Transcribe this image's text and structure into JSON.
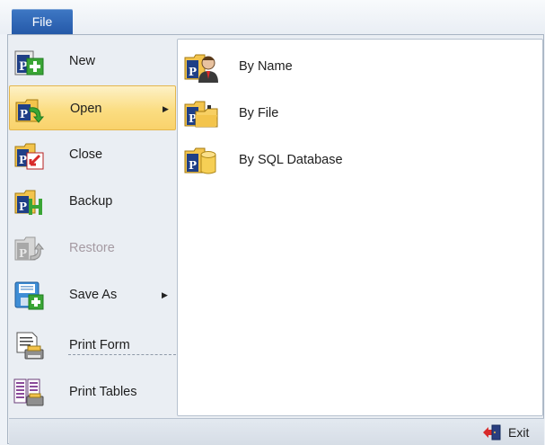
{
  "menu_tab": {
    "label": "File"
  },
  "left_menu": {
    "items": [
      {
        "label": "New",
        "icon": "new-file-icon",
        "disabled": false,
        "selected": false,
        "has_submenu": false
      },
      {
        "label": "Open",
        "icon": "open-file-icon",
        "disabled": false,
        "selected": true,
        "has_submenu": true
      },
      {
        "label": "Close",
        "icon": "close-file-icon",
        "disabled": false,
        "selected": false,
        "has_submenu": false
      },
      {
        "label": "Backup",
        "icon": "backup-icon",
        "disabled": false,
        "selected": false,
        "has_submenu": false
      },
      {
        "label": "Restore",
        "icon": "restore-icon",
        "disabled": true,
        "selected": false,
        "has_submenu": false
      },
      {
        "label": "Save As",
        "icon": "save-as-icon",
        "disabled": false,
        "selected": false,
        "has_submenu": true
      },
      {
        "label": "Print Form",
        "icon": "print-form-icon",
        "disabled": false,
        "selected": false,
        "has_submenu": false
      },
      {
        "label": "Print Tables",
        "icon": "print-tables-icon",
        "disabled": false,
        "selected": false,
        "has_submenu": false
      }
    ]
  },
  "submenu": {
    "items": [
      {
        "label": "By Name",
        "icon": "open-by-name-icon"
      },
      {
        "label": "By File",
        "icon": "open-by-file-icon"
      },
      {
        "label": "By SQL Database",
        "icon": "open-by-sql-database-icon"
      }
    ]
  },
  "footer": {
    "exit_label": "Exit",
    "exit_icon": "exit-icon"
  },
  "colors": {
    "file_tab": "#2d63b3",
    "selected_highlight": "#fbdd82",
    "disabled_text": "#a59aa2",
    "new_green": "#3aa535",
    "close_red": "#d82a2a"
  }
}
